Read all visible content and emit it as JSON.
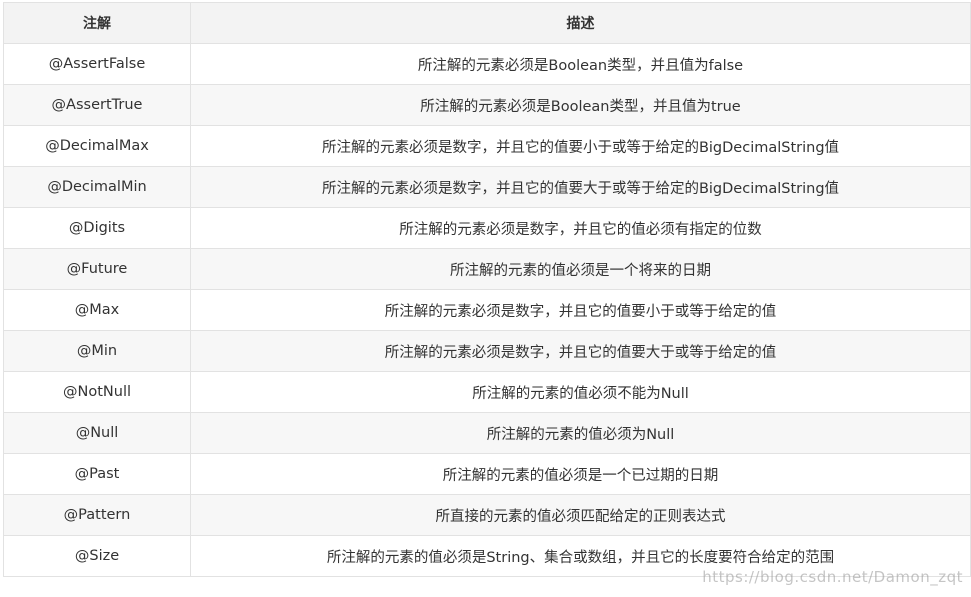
{
  "table": {
    "headers": [
      "注解",
      "描述"
    ],
    "rows": [
      [
        "@AssertFalse",
        "所注解的元素必须是Boolean类型，并且值为false"
      ],
      [
        "@AssertTrue",
        "所注解的元素必须是Boolean类型，并且值为true"
      ],
      [
        "@DecimalMax",
        "所注解的元素必须是数字，并且它的值要小于或等于给定的BigDecimalString值"
      ],
      [
        "@DecimalMin",
        "所注解的元素必须是数字，并且它的值要大于或等于给定的BigDecimalString值"
      ],
      [
        "@Digits",
        "所注解的元素必须是数字，并且它的值必须有指定的位数"
      ],
      [
        "@Future",
        "所注解的元素的值必须是一个将来的日期"
      ],
      [
        "@Max",
        "所注解的元素必须是数字，并且它的值要小于或等于给定的值"
      ],
      [
        "@Min",
        "所注解的元素必须是数字，并且它的值要大于或等于给定的值"
      ],
      [
        "@NotNull",
        "所注解的元素的值必须不能为Null"
      ],
      [
        "@Null",
        "所注解的元素的值必须为Null"
      ],
      [
        "@Past",
        "所注解的元素的值必须是一个已过期的日期"
      ],
      [
        "@Pattern",
        "所直接的元素的值必须匹配给定的正则表达式"
      ],
      [
        "@Size",
        "所注解的元素的值必须是String、集合或数组，并且它的长度要符合给定的范围"
      ]
    ]
  },
  "watermark": "https://blog.csdn.net/Damon_zqt"
}
